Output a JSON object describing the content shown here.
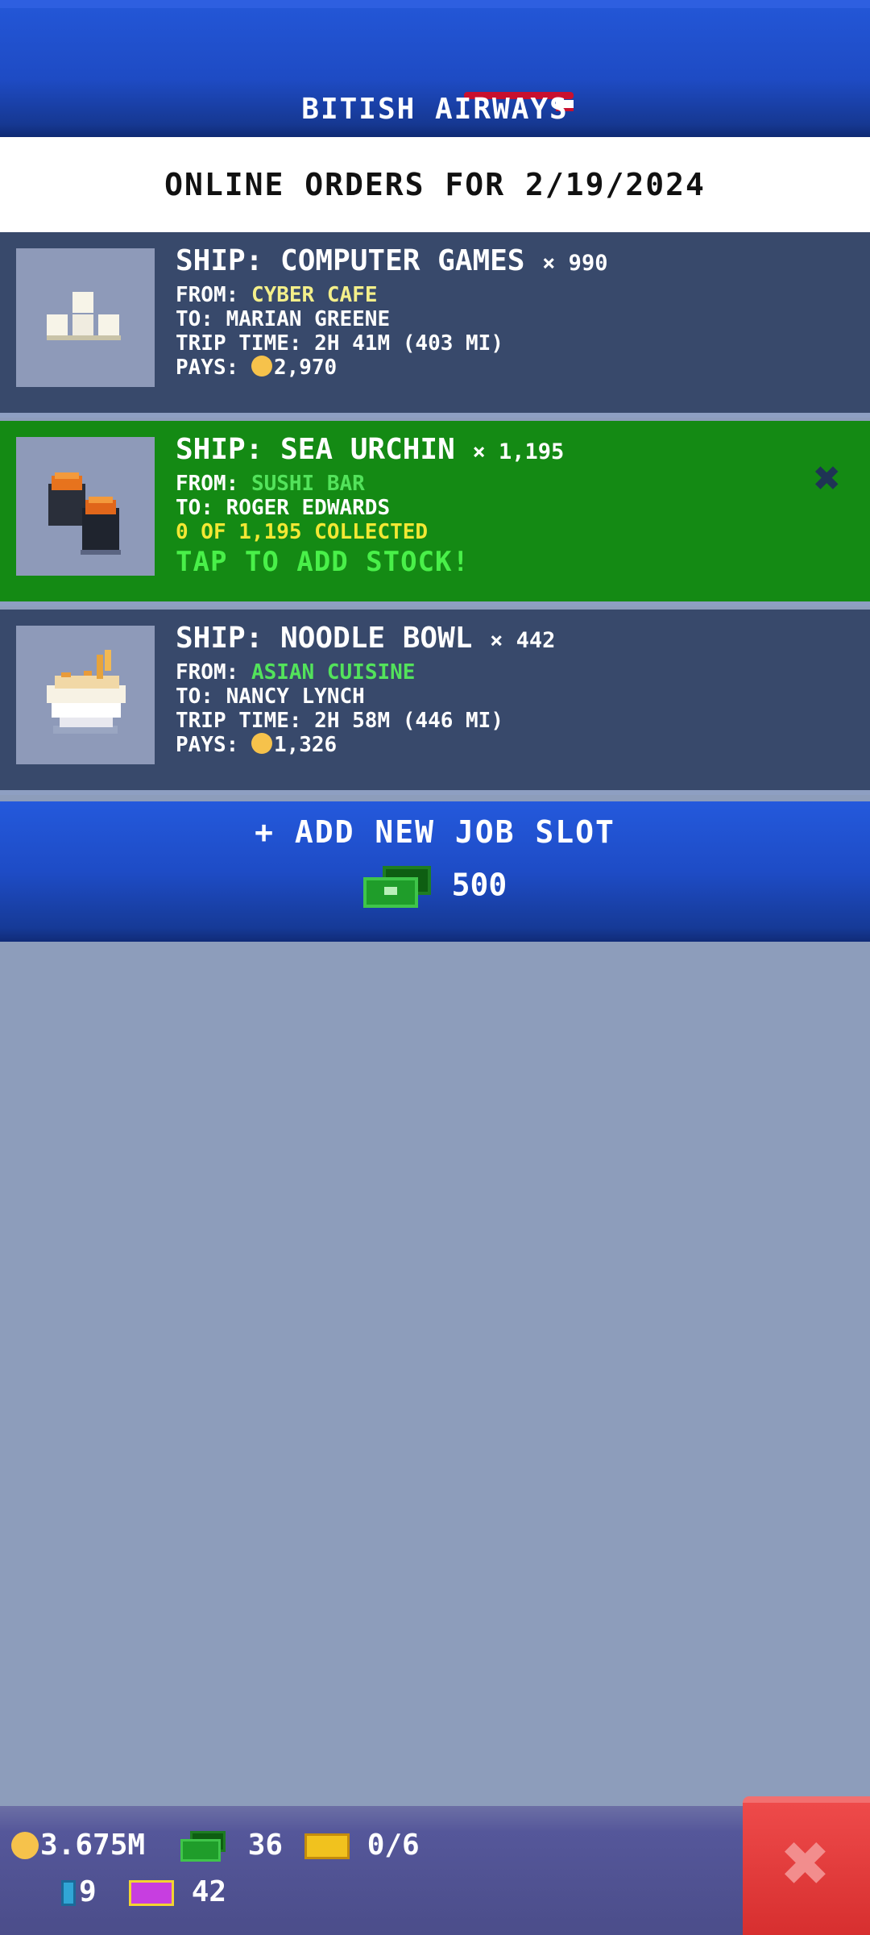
{
  "header": {
    "airline_name": "BITISH AIRWAYS"
  },
  "date_bar": {
    "title": "ONLINE ORDERS FOR 2/19/2024"
  },
  "jobs": [
    {
      "title": "SHIP: COMPUTER GAMES",
      "quantity": "× 990",
      "from_label": "FROM:",
      "from_value": "CYBER CAFE",
      "to": "TO: MARIAN GREENE",
      "trip": "TRIP TIME: 2H 41M (403 MI)",
      "pays_label": "PAYS:",
      "pays_value": "2,970",
      "icon": "computer-games-icon"
    },
    {
      "title": "SHIP: SEA URCHIN",
      "quantity": "× 1,195",
      "from_label": "FROM:",
      "from_value": "SUSHI BAR",
      "to": "TO: ROGER EDWARDS",
      "collected": "0 OF 1,195 COLLECTED",
      "cta": "TAP TO ADD STOCK!",
      "icon": "sea-urchin-icon",
      "dismiss_glyph": "✖"
    },
    {
      "title": "SHIP: NOODLE BOWL",
      "quantity": "× 442",
      "from_label": "FROM:",
      "from_value": "ASIAN CUISINE",
      "to": "TO: NANCY LYNCH",
      "trip": "TRIP TIME: 2H 58M (446 MI)",
      "pays_label": "PAYS:",
      "pays_value": "1,326",
      "icon": "noodle-bowl-icon"
    }
  ],
  "add_slot": {
    "label": "+ ADD NEW JOB SLOT",
    "cost": "500"
  },
  "status_bar": {
    "coins": "3.675M",
    "cash": "36",
    "tickets": "0/6",
    "bottles": "9",
    "purple_tickets": "42"
  },
  "close_glyph": "✖",
  "colors": {
    "header_blue": "#2356d6",
    "job_card_blue": "#38496b",
    "job_card_active_green": "#148a14",
    "close_red": "#e03b3b"
  }
}
